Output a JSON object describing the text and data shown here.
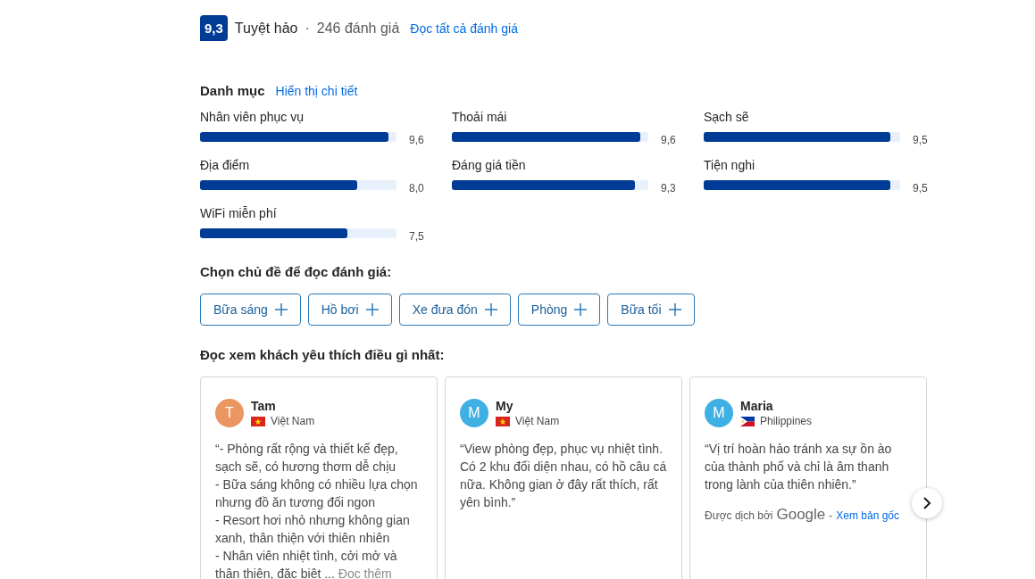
{
  "rating": {
    "score": "9,3",
    "label": "Tuyệt hảo",
    "separator": "·",
    "count": "246 đánh giá",
    "link": "Đọc tất cả đánh giá"
  },
  "categories": {
    "title": "Danh mục",
    "link": "Hiển thị chi tiết",
    "items": [
      {
        "name": "Nhân viên phục vụ",
        "score": "9,6",
        "level": 0.96
      },
      {
        "name": "Thoải mái",
        "score": "9,6",
        "level": 0.96
      },
      {
        "name": "Sạch sẽ",
        "score": "9,5",
        "level": 0.95
      },
      {
        "name": "Địa điểm",
        "score": "8,0",
        "level": 0.8
      },
      {
        "name": "Đáng giá tiền",
        "score": "9,3",
        "level": 0.93
      },
      {
        "name": "Tiện nghi",
        "score": "9,5",
        "level": 0.95
      },
      {
        "name": "WiFi miễn phí",
        "score": "7,5",
        "level": 0.75
      }
    ]
  },
  "topics": {
    "title": "Chọn chủ đề để đọc đánh giá:",
    "items": [
      "Bữa sáng",
      "Hồ bơi",
      "Xe đưa đón",
      "Phòng",
      "Bữa tối"
    ]
  },
  "reviews": {
    "title": "Đọc xem khách yêu thích điều gì nhất:",
    "items": [
      {
        "initial": "T",
        "color": "#eb9560",
        "name": "Tam",
        "kind": "vn",
        "country": "Việt Nam",
        "text": "“- Phòng rất rộng và thiết kế đẹp, sạch sẽ, có hương thơm dễ chịu\n- Bữa sáng không có nhiều lựa chọn nhưng đồ ăn tương đối ngon\n- Resort hơi nhỏ nhưng không gian xanh, thân thiện với thiên nhiên\n- Nhân viên nhiệt tình, cởi mở và thân thiện, đặc biệt ...",
        "read_more": "Đọc thêm"
      },
      {
        "initial": "M",
        "color": "#3fb0e3",
        "name": "My",
        "kind": "vn",
        "country": "Việt Nam",
        "text": "“View phòng đẹp, phục vụ nhiệt tình. Có 2 khu đối diện nhau, có hồ câu cá nữa. Không gian ở đây rất thích, rất yên bình.”"
      },
      {
        "initial": "M",
        "color": "#3fb0e3",
        "name": "Maria",
        "kind": "ph",
        "country": "Philippines",
        "text": "“Vị trí hoàn hảo tránh xa sự ồn ào của thành phố và chỉ là âm thanh trong lành của thiên nhiên.”",
        "translation": {
          "label": "Được dịch bởi",
          "service": "Google",
          "separator": "-",
          "link": "Xem bản gốc"
        }
      }
    ]
  }
}
